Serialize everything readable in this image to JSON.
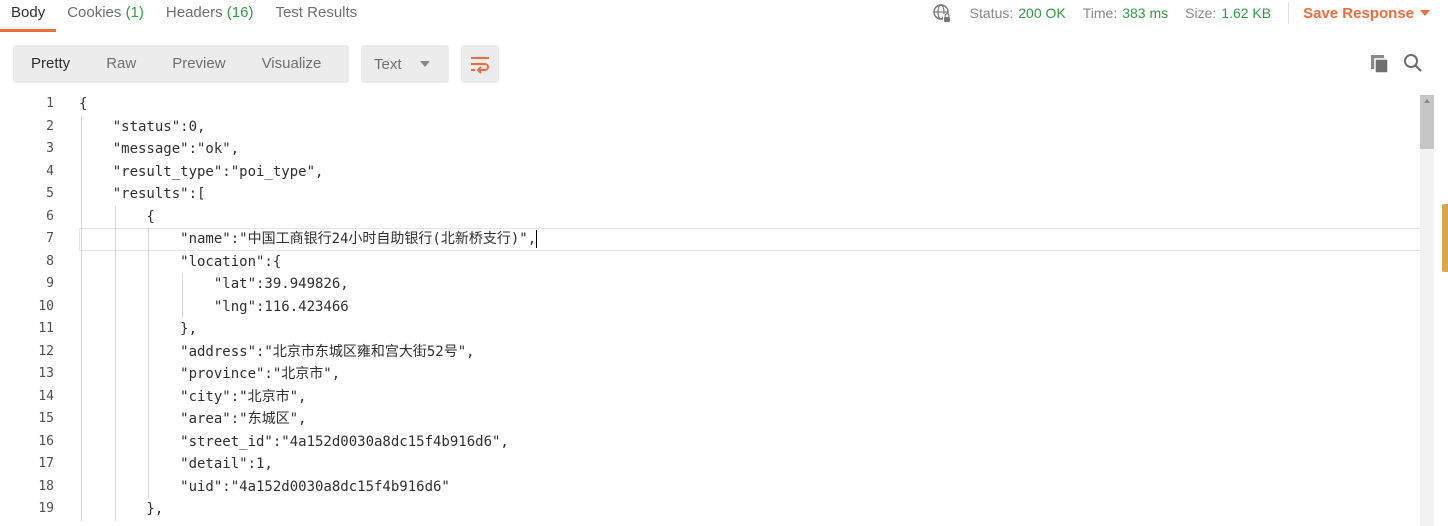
{
  "tabs": [
    {
      "label": "Body",
      "count": ""
    },
    {
      "label": "Cookies ",
      "count": "(1)"
    },
    {
      "label": "Headers ",
      "count": "(16)"
    },
    {
      "label": "Test Results",
      "count": ""
    }
  ],
  "status": {
    "status_label": "Status:",
    "status_value": "200 OK",
    "time_label": "Time:",
    "time_value": "383 ms",
    "size_label": "Size:",
    "size_value": "1.62 KB",
    "save_label": "Save Response"
  },
  "format": {
    "modes": [
      "Pretty",
      "Raw",
      "Preview",
      "Visualize"
    ],
    "active": "Pretty",
    "type_select": "Text"
  },
  "icons": {
    "globe": "globe-icon",
    "copy": "copy-icon",
    "search": "search-icon",
    "wrap": "wrap-lines-icon"
  },
  "colors": {
    "accent": "#f26b3a",
    "success": "#2f9e44"
  },
  "editor": {
    "current_line": 7,
    "lines": [
      "{",
      "    \"status\":0,",
      "    \"message\":\"ok\",",
      "    \"result_type\":\"poi_type\",",
      "    \"results\":[",
      "        {",
      "            \"name\":\"中国工商银行24小时自助银行(北新桥支行)\",",
      "            \"location\":{",
      "                \"lat\":39.949826,",
      "                \"lng\":116.423466",
      "            },",
      "            \"address\":\"北京市东城区雍和宫大街52号\",",
      "            \"province\":\"北京市\",",
      "            \"city\":\"北京市\",",
      "            \"area\":\"东城区\",",
      "            \"street_id\":\"4a152d0030a8dc15f4b916d6\",",
      "            \"detail\":1,",
      "            \"uid\":\"4a152d0030a8dc15f4b916d6\"",
      "        },"
    ]
  }
}
